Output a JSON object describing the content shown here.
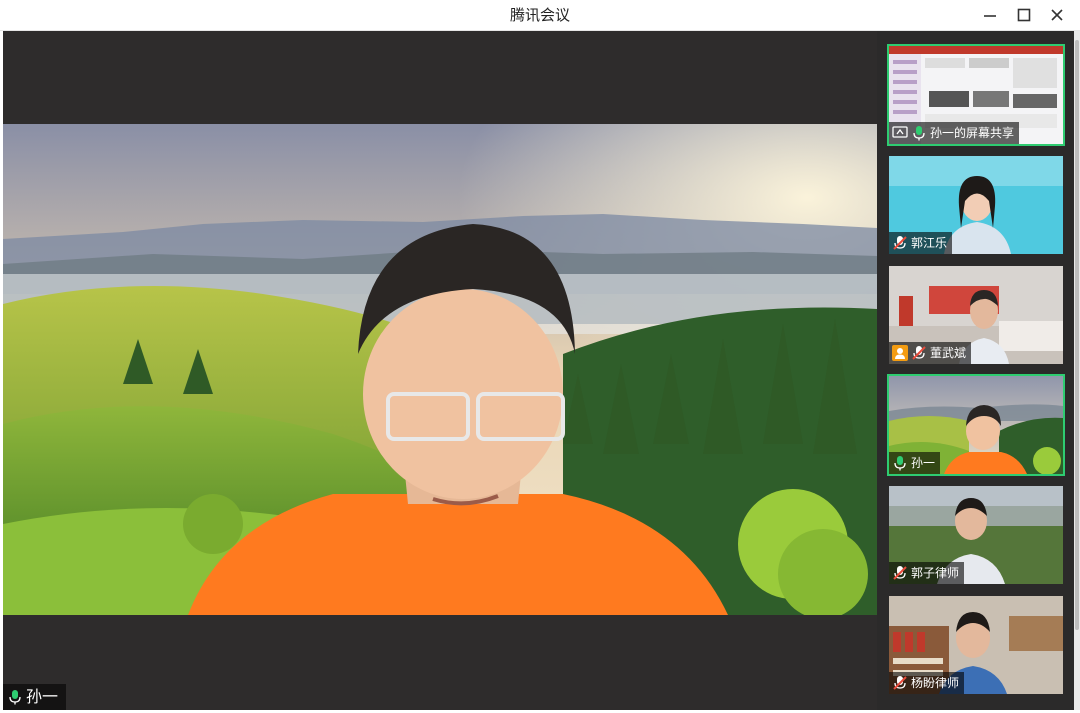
{
  "window": {
    "title": "腾讯会议",
    "minimize_icon": "minimize-icon",
    "maximize_icon": "maximize-icon",
    "close_icon": "close-icon"
  },
  "main_video": {
    "speaker_name": "孙一",
    "mic_status": "active"
  },
  "participants": [
    {
      "name": "孙一的屏幕共享",
      "mic": "active",
      "kind": "screen-share"
    },
    {
      "name": "郭江乐",
      "mic": "muted",
      "kind": "camera"
    },
    {
      "name": "董武斌",
      "mic": "muted",
      "kind": "camera",
      "host": true
    },
    {
      "name": "孙一",
      "mic": "active",
      "kind": "camera"
    },
    {
      "name": "郭子律师",
      "mic": "muted",
      "kind": "camera"
    },
    {
      "name": "杨盼律师",
      "mic": "muted",
      "kind": "camera"
    }
  ],
  "colors": {
    "active_mic": "#2ecc71",
    "muted_mic": "#e74c3c",
    "active_border": "#2ecc71",
    "host_badge": "#f39c12"
  }
}
